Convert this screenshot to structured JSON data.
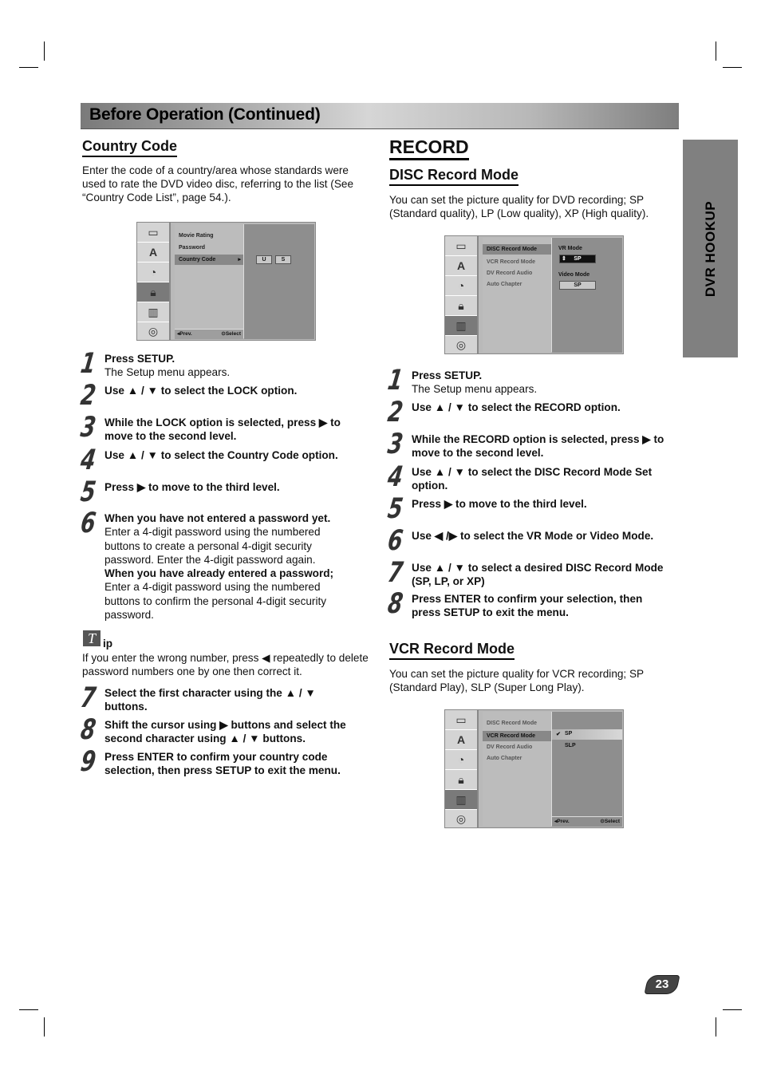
{
  "header": {
    "banner_title": "Before Operation (Continued)",
    "side_tab": "DVR HOOKUP",
    "page_number": "23"
  },
  "country_code": {
    "title": "Country Code",
    "intro": "Enter the code of a country/area whose standards were used to rate the DVD video disc, referring to the list (See “Country Code List”, page 54.).",
    "menu": {
      "items": [
        "Movie Rating",
        "Password",
        "Country Code"
      ],
      "selected": "Country Code",
      "code_chars": [
        "U",
        "S"
      ],
      "footer_prev": "Prev.",
      "footer_select": "Select",
      "active_icon": "lock-icon"
    },
    "steps": [
      {
        "num": "1",
        "bold": "Press SETUP.",
        "text": "The Setup menu appears."
      },
      {
        "num": "2",
        "bold": "Use ▲ / ▼ to select the LOCK option.",
        "text": ""
      },
      {
        "num": "3",
        "bold": "While the LOCK option is selected, press ▶ to move to the second level.",
        "text": ""
      },
      {
        "num": "4",
        "bold": "Use ▲ / ▼ to select the Country Code option.",
        "text": ""
      },
      {
        "num": "5",
        "bold": "Press ▶ to move to the third level.",
        "text": ""
      },
      {
        "num": "6",
        "bold": "When you have not entered a password yet.",
        "text": "Enter a 4-digit password using the numbered buttons to create a personal 4-digit security password. Enter the 4-digit password again.",
        "bold2": "When you have already entered a password;",
        "text2": "Enter a 4-digit password using the numbered buttons to confirm the personal 4-digit security password."
      },
      {
        "num": "7",
        "bold": "Select the first character using the ▲ / ▼ buttons.",
        "text": ""
      },
      {
        "num": "8",
        "bold": "Shift the cursor using ▶ buttons and select the second character using ▲ / ▼ buttons.",
        "text": ""
      },
      {
        "num": "9",
        "bold": "Press ENTER to confirm your country code selection, then press SETUP to exit the menu.",
        "text": ""
      }
    ],
    "tip": {
      "label": "ip",
      "text": "If you enter the wrong number, press ◀ repeatedly to delete password numbers one by one then correct it."
    }
  },
  "record": {
    "title": "RECORD",
    "disc": {
      "title": "DISC Record Mode",
      "intro": "You can set the picture quality for DVD recording; SP (Standard quality), LP (Low quality), XP (High quality).",
      "menu": {
        "items": [
          "DISC Record Mode",
          "VCR Record Mode",
          "DV Record Audio",
          "Auto Chapter"
        ],
        "selected": "DISC Record Mode",
        "vr_mode_label": "VR Mode",
        "vr_mode_value": "SP",
        "video_mode_label": "Video Mode",
        "video_mode_value": "SP"
      },
      "steps": [
        {
          "num": "1",
          "bold": "Press SETUP.",
          "text": "The Setup menu appears."
        },
        {
          "num": "2",
          "bold": "Use ▲ / ▼ to select the RECORD option.",
          "text": ""
        },
        {
          "num": "3",
          "bold": "While the RECORD option is selected, press ▶ to move to the second level.",
          "text": ""
        },
        {
          "num": "4",
          "bold": "Use ▲ / ▼ to select the DISC Record Mode Set option.",
          "text": ""
        },
        {
          "num": "5",
          "bold": "Press ▶ to move to the third level.",
          "text": ""
        },
        {
          "num": "6",
          "bold": "Use ◀ /▶ to select the VR Mode or Video Mode.",
          "text": ""
        },
        {
          "num": "7",
          "bold": "Use ▲ / ▼ to select a desired DISC Record Mode (SP, LP, or XP)",
          "text": ""
        },
        {
          "num": "8",
          "bold": "Press ENTER to confirm your selection, then press SETUP to exit the menu.",
          "text": ""
        }
      ]
    },
    "vcr": {
      "title": "VCR Record Mode",
      "intro": "You can set the picture quality for VCR recording; SP (Standard Play), SLP (Super Long Play).",
      "menu": {
        "items": [
          "DISC Record Mode",
          "VCR Record Mode",
          "DV Record Audio",
          "Auto Chapter"
        ],
        "selected": "VCR Record Mode",
        "options": [
          "SP",
          "SLP"
        ],
        "checked": "SP",
        "footer_prev": "Prev.",
        "footer_select": "Select"
      }
    }
  }
}
